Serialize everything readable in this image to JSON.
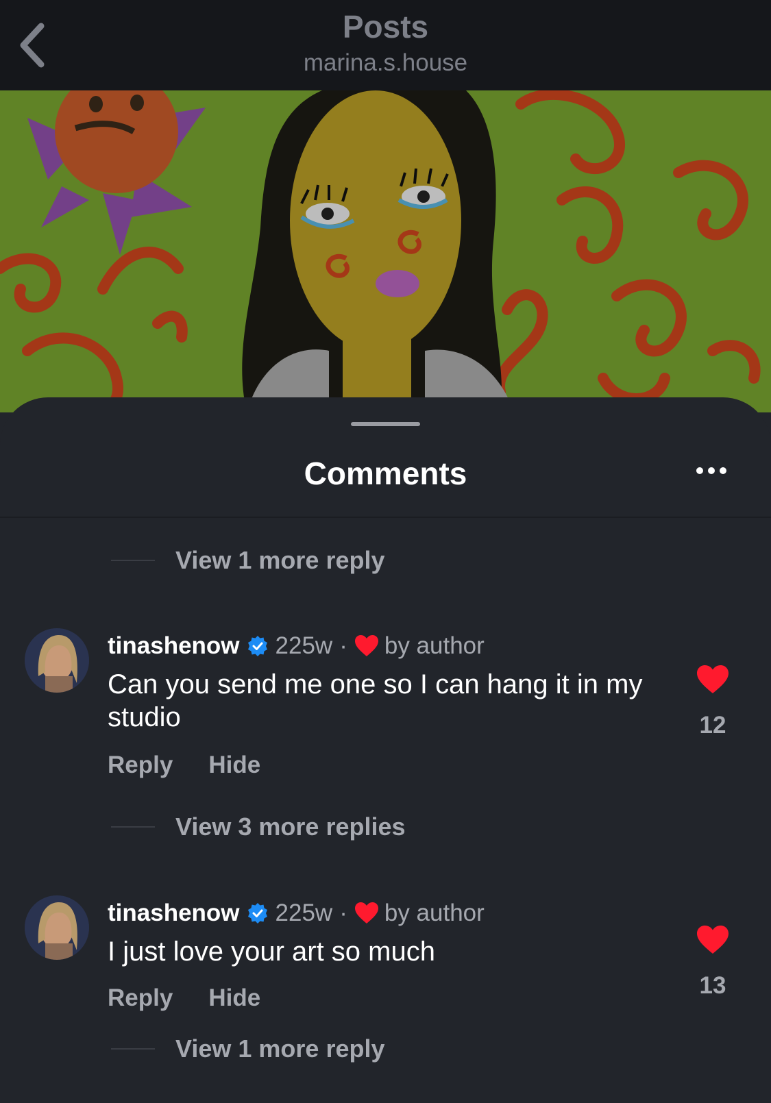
{
  "nav": {
    "title": "Posts",
    "subtitle": "marina.s.house",
    "back_icon": "chevron-left-icon"
  },
  "post": {
    "image_description_icon": "painting-image"
  },
  "comments_sheet": {
    "title": "Comments",
    "more_icon": "more-horizontal-icon",
    "view_replies_top": "View 1 more reply",
    "comments": [
      {
        "username": "tinashenow",
        "verified": true,
        "time": "225w",
        "separator": "·",
        "liked_by_author_label": "by author",
        "text": "Can you send me one so I can hang it in my studio",
        "reply_label": "Reply",
        "hide_label": "Hide",
        "likes": "12",
        "liked": true,
        "view_replies": "View 3 more replies"
      },
      {
        "username": "tinashenow",
        "verified": true,
        "time": "225w",
        "separator": "·",
        "liked_by_author_label": "by author",
        "text": "I just love your art so much",
        "reply_label": "Reply",
        "hide_label": "Hide",
        "likes": "13",
        "liked": true,
        "view_replies": "View 1 more reply"
      }
    ]
  },
  "colors": {
    "background": "#22252b",
    "nav_background": "#15171b",
    "heart": "#ff1a2e",
    "verified": "#1d8cf5",
    "muted_text": "#a6a9b0"
  }
}
